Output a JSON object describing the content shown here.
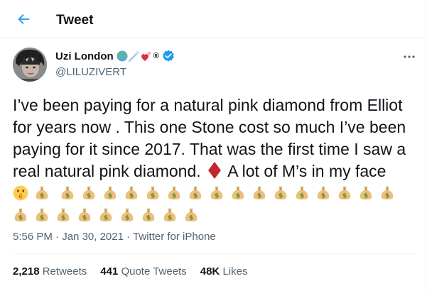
{
  "header": {
    "title": "Tweet",
    "back_icon": "arrow-left-icon",
    "accent": "#1d9bf0"
  },
  "author": {
    "name": "Uzi London",
    "handle": "@LILUZIVERT",
    "name_emojis": [
      "globe-icon",
      "comet-icon",
      "hearts-icon"
    ],
    "registered_mark": "®",
    "verified": true
  },
  "tweet": {
    "lines": [
      "I’ve been paying for a natural pink diamond from Elliot",
      "for years now . This one Stone cost so much I’ve been",
      "paying for it since 2017. That was the first time I saw a",
      "real natural pink diamond.",
      "A lot of M’s in my face"
    ],
    "emoji_line_1": [
      "shushing-face",
      "money-bag",
      "money-bag",
      "money-bag",
      "money-bag",
      "money-bag",
      "money-bag",
      "money-bag",
      "money-bag",
      "money-bag",
      "money-bag",
      "money-bag",
      "money-bag",
      "money-bag",
      "money-bag",
      "money-bag",
      "money-bag",
      "money-bag"
    ],
    "emoji_line_2_count": 9
  },
  "meta": {
    "time": "5:56 PM",
    "date": "Jan 30, 2021",
    "separator": "·",
    "source": "Twitter for iPhone"
  },
  "stats": {
    "retweets": {
      "count": "2,218",
      "label": "Retweets"
    },
    "quotes": {
      "count": "441",
      "label": "Quote Tweets"
    },
    "likes": {
      "count": "48K",
      "label": "Likes"
    }
  }
}
